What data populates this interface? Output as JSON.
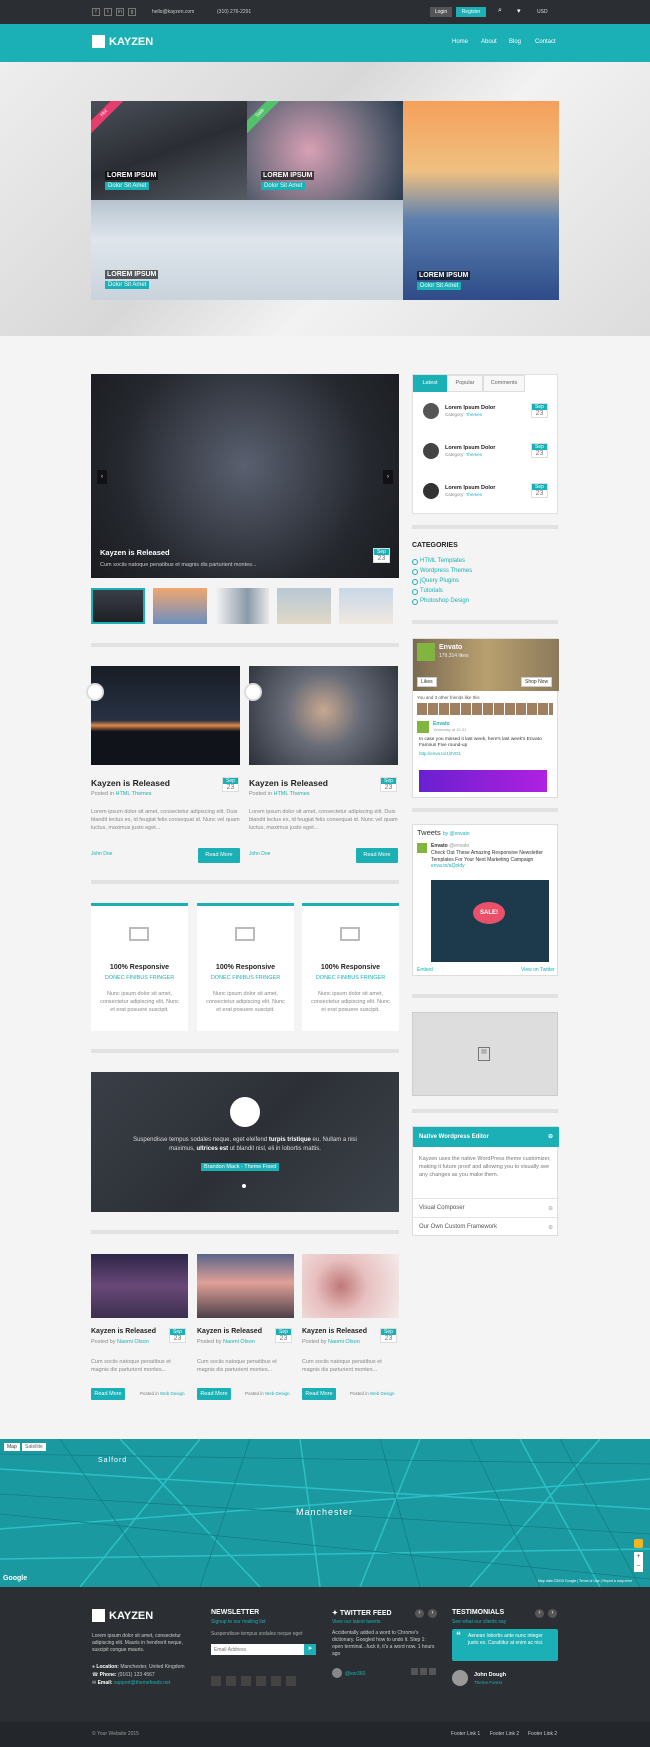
{
  "topbar": {
    "email": "hello@kayzen.com",
    "phone": "(310) 276-2291",
    "login": "Login",
    "register": "Register",
    "currency": "USD"
  },
  "brand": "KAYZEN",
  "nav": [
    "Home",
    "About",
    "Blog",
    "Contact"
  ],
  "hero": {
    "hot": "Hot",
    "sale": "Sale",
    "tiles": [
      {
        "title": "LOREM IPSUM",
        "sub": "Dolor Sit Amet"
      },
      {
        "title": "LOREM IPSUM",
        "sub": "Dolor Sit Amet"
      },
      {
        "title": "LOREM IPSUM",
        "sub": "Dolor Sit Amet"
      },
      {
        "title": "LOREM IPSUM",
        "sub": "Dolor Sit Amet"
      }
    ]
  },
  "slider": {
    "title": "Kayzen is Released",
    "text": "Cum sociis natoque penatibus et magnis dis parturient montes...",
    "month": "Sep",
    "day": "23"
  },
  "tabs": [
    "Latest",
    "Popular",
    "Comments"
  ],
  "latest": [
    {
      "title": "Lorem Ipsum Dolor",
      "category": "Category:",
      "cat": "Themes",
      "month": "Sep",
      "day": "23"
    },
    {
      "title": "Lorem Ipsum Dolor",
      "category": "Category:",
      "cat": "Themes",
      "month": "Sep",
      "day": "23"
    },
    {
      "title": "Lorem Ipsum Dolor",
      "category": "Category:",
      "cat": "Themes",
      "month": "Sep",
      "day": "23"
    }
  ],
  "categories": {
    "title": "CATEGORIES",
    "items": [
      "HTML Templates",
      "Wordpress Themes",
      "jQuery Plugins",
      "Tutorials",
      "Photoshop Design"
    ]
  },
  "posts": [
    {
      "title": "Kayzen is Released",
      "posted": "Posted in",
      "cat": "HTML Themes",
      "month": "Sep",
      "day": "23",
      "text": "Lorem ipsum dolor sit amet, consectetur adipiscing elit. Duis blandit lectus ex, id feugiat felis consequat id. Nunc vel quam luctus, maximus justo eget...",
      "author": "John Doe",
      "btn": "Read More"
    },
    {
      "title": "Kayzen is Released",
      "posted": "Posted in",
      "cat": "HTML Themes",
      "month": "Sep",
      "day": "23",
      "text": "Lorem ipsum dolor sit amet, consectetur adipiscing elit. Duis blandit lectus ex, id feugiat felis consequat id. Nunc vel quam luctus, maximus justo eget...",
      "author": "John Doe",
      "btn": "Read More"
    }
  ],
  "fb": {
    "name": "Envato",
    "likes": "179,314 likes",
    "like": "Likes",
    "shop": "Shop Now",
    "friends": "You and 3 other friends like this",
    "post_name": "Envato",
    "post_date": "Yesterday at 10:31",
    "post_text": "In case you missed it last week, here's last week's Envato Famous Five round-up",
    "post_link": "http://enva.to/1l2VD1"
  },
  "tw": {
    "title": "Tweets",
    "by": "by @envato",
    "name": "Envato",
    "handle": "@envato",
    "text": "Check Out These Amazing Responsive Newsletter Templates For Your Next Marketing Campaign",
    "link": "enva.to/aQoldy",
    "sale": "SALE!",
    "embed": "Embed",
    "view": "View on Twitter"
  },
  "features": [
    {
      "title": "100% Responsive",
      "sub": "DONEC FINIBUS FRINGER",
      "text": "Nunc ipsum dolor sit amet, consectetur adipiscing elit. Nunc et erat posuere suscipit."
    },
    {
      "title": "100% Responsive",
      "sub": "DONEC FINIBUS FRINGER",
      "text": "Nunc ipsum dolor sit amet, consectetur adipiscing elit. Nunc et erat posuere suscipit."
    },
    {
      "title": "100% Responsive",
      "sub": "DONEC FINIBUS FRINGER",
      "text": "Nunc ipsum dolor sit amet, consectetur adipiscing elit. Nunc et erat posuere suscipit."
    }
  ],
  "testi": {
    "text1": "Suspendisse tempus sodales neque, eget eleifend ",
    "bold1": "turpis tristique",
    "text2": " eu. Nullam a nisi maximus, ",
    "bold2": "ultrices est",
    "text3": " ut blandit nisl, eli in lobortis mattis.",
    "author": "Brandon Mack - Theme Fixed"
  },
  "accordion": {
    "open": "Native Wordpress Editor",
    "text": "Kayzen uses the native WordPress theme customizer, making it future proof and allowing you to visually see any changes as you make them.",
    "item2": "Visual Composer",
    "item3": "Our Own Custom Framework"
  },
  "small": [
    {
      "title": "Kayzen is Released",
      "posted": "Posted by",
      "author": "Naomi Olson",
      "month": "Sep",
      "day": "23",
      "text": "Cum sociis natoque penatibus et magnis dis parturient montes...",
      "btn": "Read More",
      "in": "Posted in",
      "cat": "Web Design"
    },
    {
      "title": "Kayzen is Released",
      "posted": "Posted by",
      "author": "Naomi Olson",
      "month": "Sep",
      "day": "23",
      "text": "Cum sociis natoque penatibus et magnis dis parturient montes...",
      "btn": "Read More",
      "in": "Posted in",
      "cat": "Web Design"
    },
    {
      "title": "Kayzen is Released",
      "posted": "Posted by",
      "author": "Naomi Olson",
      "month": "Sep",
      "day": "23",
      "text": "Cum sociis natoque penatibus et magnis dis parturient montes...",
      "btn": "Read More",
      "in": "Posted in",
      "cat": "Web Design"
    }
  ],
  "map": {
    "map": "Map",
    "sat": "Satellite",
    "city": "Manchester",
    "salford": "Salford",
    "google": "Google",
    "credits": "Map data ©2015 Google | Terms of Use | Report a map error"
  },
  "footer": {
    "about": "Lorem ipsum dolor sit amet, consectetur adipiscing elit. Mauris in hendrerit neque, suscipit congue mauris.",
    "loc_l": "Location:",
    "loc": "Manchester, United Kingdom",
    "ph_l": "Phone:",
    "ph": "(0161) 123 4567",
    "em_l": "Email:",
    "em": "support@themefeeds.net",
    "news_t": "NEWSLETTER",
    "news_s": "Signup to our mailing list",
    "news_p": "Suspendisse tempus sodales neque eget",
    "news_ph": "Email Address",
    "tw_t": "TWITTER FEED",
    "tw_s": "View our latest tweets",
    "tw_text": "Accidentally added a word to Chrome's dictionary. Googled how to undo it. Step 1: open terminal...fuck it, it's a word now. 1 hours ago",
    "tw_user": "@esr360",
    "te_t": "TESTIMONIALS",
    "te_s": "See what our clients say",
    "te_text": "Aenean lobortis ante nunc integer justo ex. Curabitur at enim ac nisi.",
    "te_name": "John Dough",
    "te_role": "Theme Forest",
    "copy": "© Your Website 2015",
    "links": [
      "Footer Link 1",
      "Footer Link 2",
      "Footer Link 2"
    ]
  },
  "colors": {
    "accent": "#1ab0b5",
    "dark": "#2b2f33"
  }
}
